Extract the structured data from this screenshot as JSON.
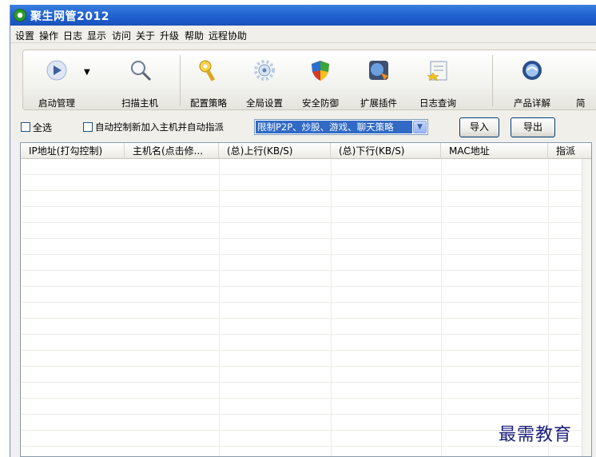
{
  "window": {
    "title": "聚生网管2012"
  },
  "menubar": {
    "items": [
      "设置",
      "操作",
      "日志",
      "显示",
      "访问",
      "关于",
      "升级",
      "帮助",
      "远程协助"
    ]
  },
  "toolbar": {
    "items": [
      {
        "label": "启动管理",
        "icon": "play-icon"
      },
      {
        "label": "扫描主机",
        "icon": "magnifier-icon"
      },
      {
        "label": "配置策略",
        "icon": "key-icon"
      },
      {
        "label": "全局设置",
        "icon": "gear-icon"
      },
      {
        "label": "安全防御",
        "icon": "shield-icon"
      },
      {
        "label": "扩展插件",
        "icon": "plugin-icon"
      },
      {
        "label": "日志查询",
        "icon": "log-icon"
      },
      {
        "label": "产品详解",
        "icon": "product-icon"
      },
      {
        "label": "简",
        "icon": "partial-icon"
      }
    ]
  },
  "filter": {
    "select_all": "全选",
    "auto_control": "自动控制新加入主机并自动指派",
    "policy_value": "限制P2P、炒股、游戏、聊天策略",
    "import_label": "导入",
    "export_label": "导出"
  },
  "table": {
    "columns": [
      "IP地址(打勾控制)",
      "主机名(点击修...",
      "(总)上行(KB/S)",
      "(总)下行(KB/S)",
      "MAC地址",
      "指派"
    ]
  },
  "watermark": "最需教育"
}
